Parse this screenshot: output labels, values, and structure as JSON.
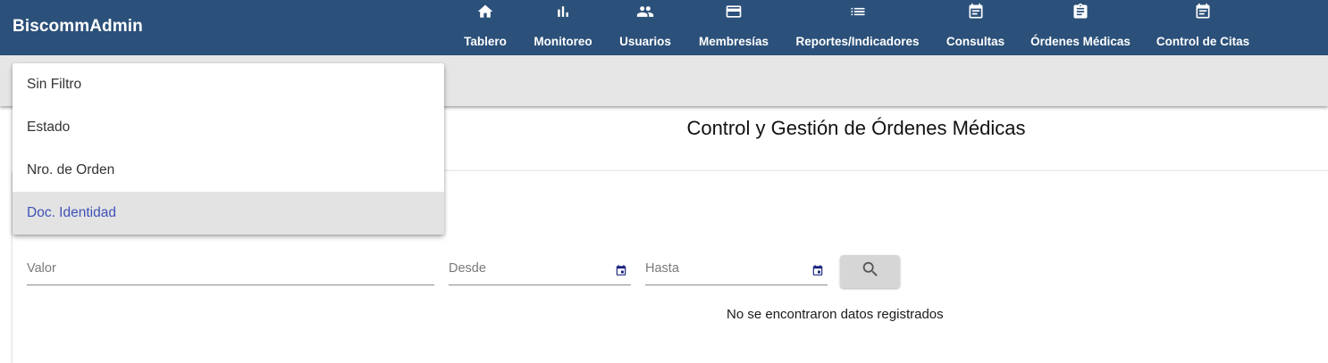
{
  "app": {
    "brand": "BiscommAdmin"
  },
  "nav": [
    {
      "label": "Tablero",
      "icon": "home-icon"
    },
    {
      "label": "Monitoreo",
      "icon": "bar-chart-icon"
    },
    {
      "label": "Usuarios",
      "icon": "people-icon"
    },
    {
      "label": "Membresías",
      "icon": "credit-card-icon"
    },
    {
      "label": "Reportes/Indicadores",
      "icon": "list-icon"
    },
    {
      "label": "Consultas",
      "icon": "event-note-icon"
    },
    {
      "label": "Órdenes Médicas",
      "icon": "assignment-icon"
    },
    {
      "label": "Control de Citas",
      "icon": "event-note-icon"
    }
  ],
  "page": {
    "title": "Control y Gestión de Órdenes Médicas"
  },
  "filter_menu": {
    "options": [
      "Sin Filtro",
      "Estado",
      "Nro. de Orden",
      "Doc. Identidad"
    ],
    "selected": "Doc. Identidad"
  },
  "form": {
    "valor_placeholder": "Valor",
    "desde_placeholder": "Desde",
    "hasta_placeholder": "Hasta"
  },
  "results": {
    "empty_message": "No se encontraron datos registrados"
  },
  "colors": {
    "topbar": "#2b5079",
    "toolbar": "#e6e6e6",
    "selected_text": "#3f51b5",
    "calendar_icon": "#1a237e"
  }
}
